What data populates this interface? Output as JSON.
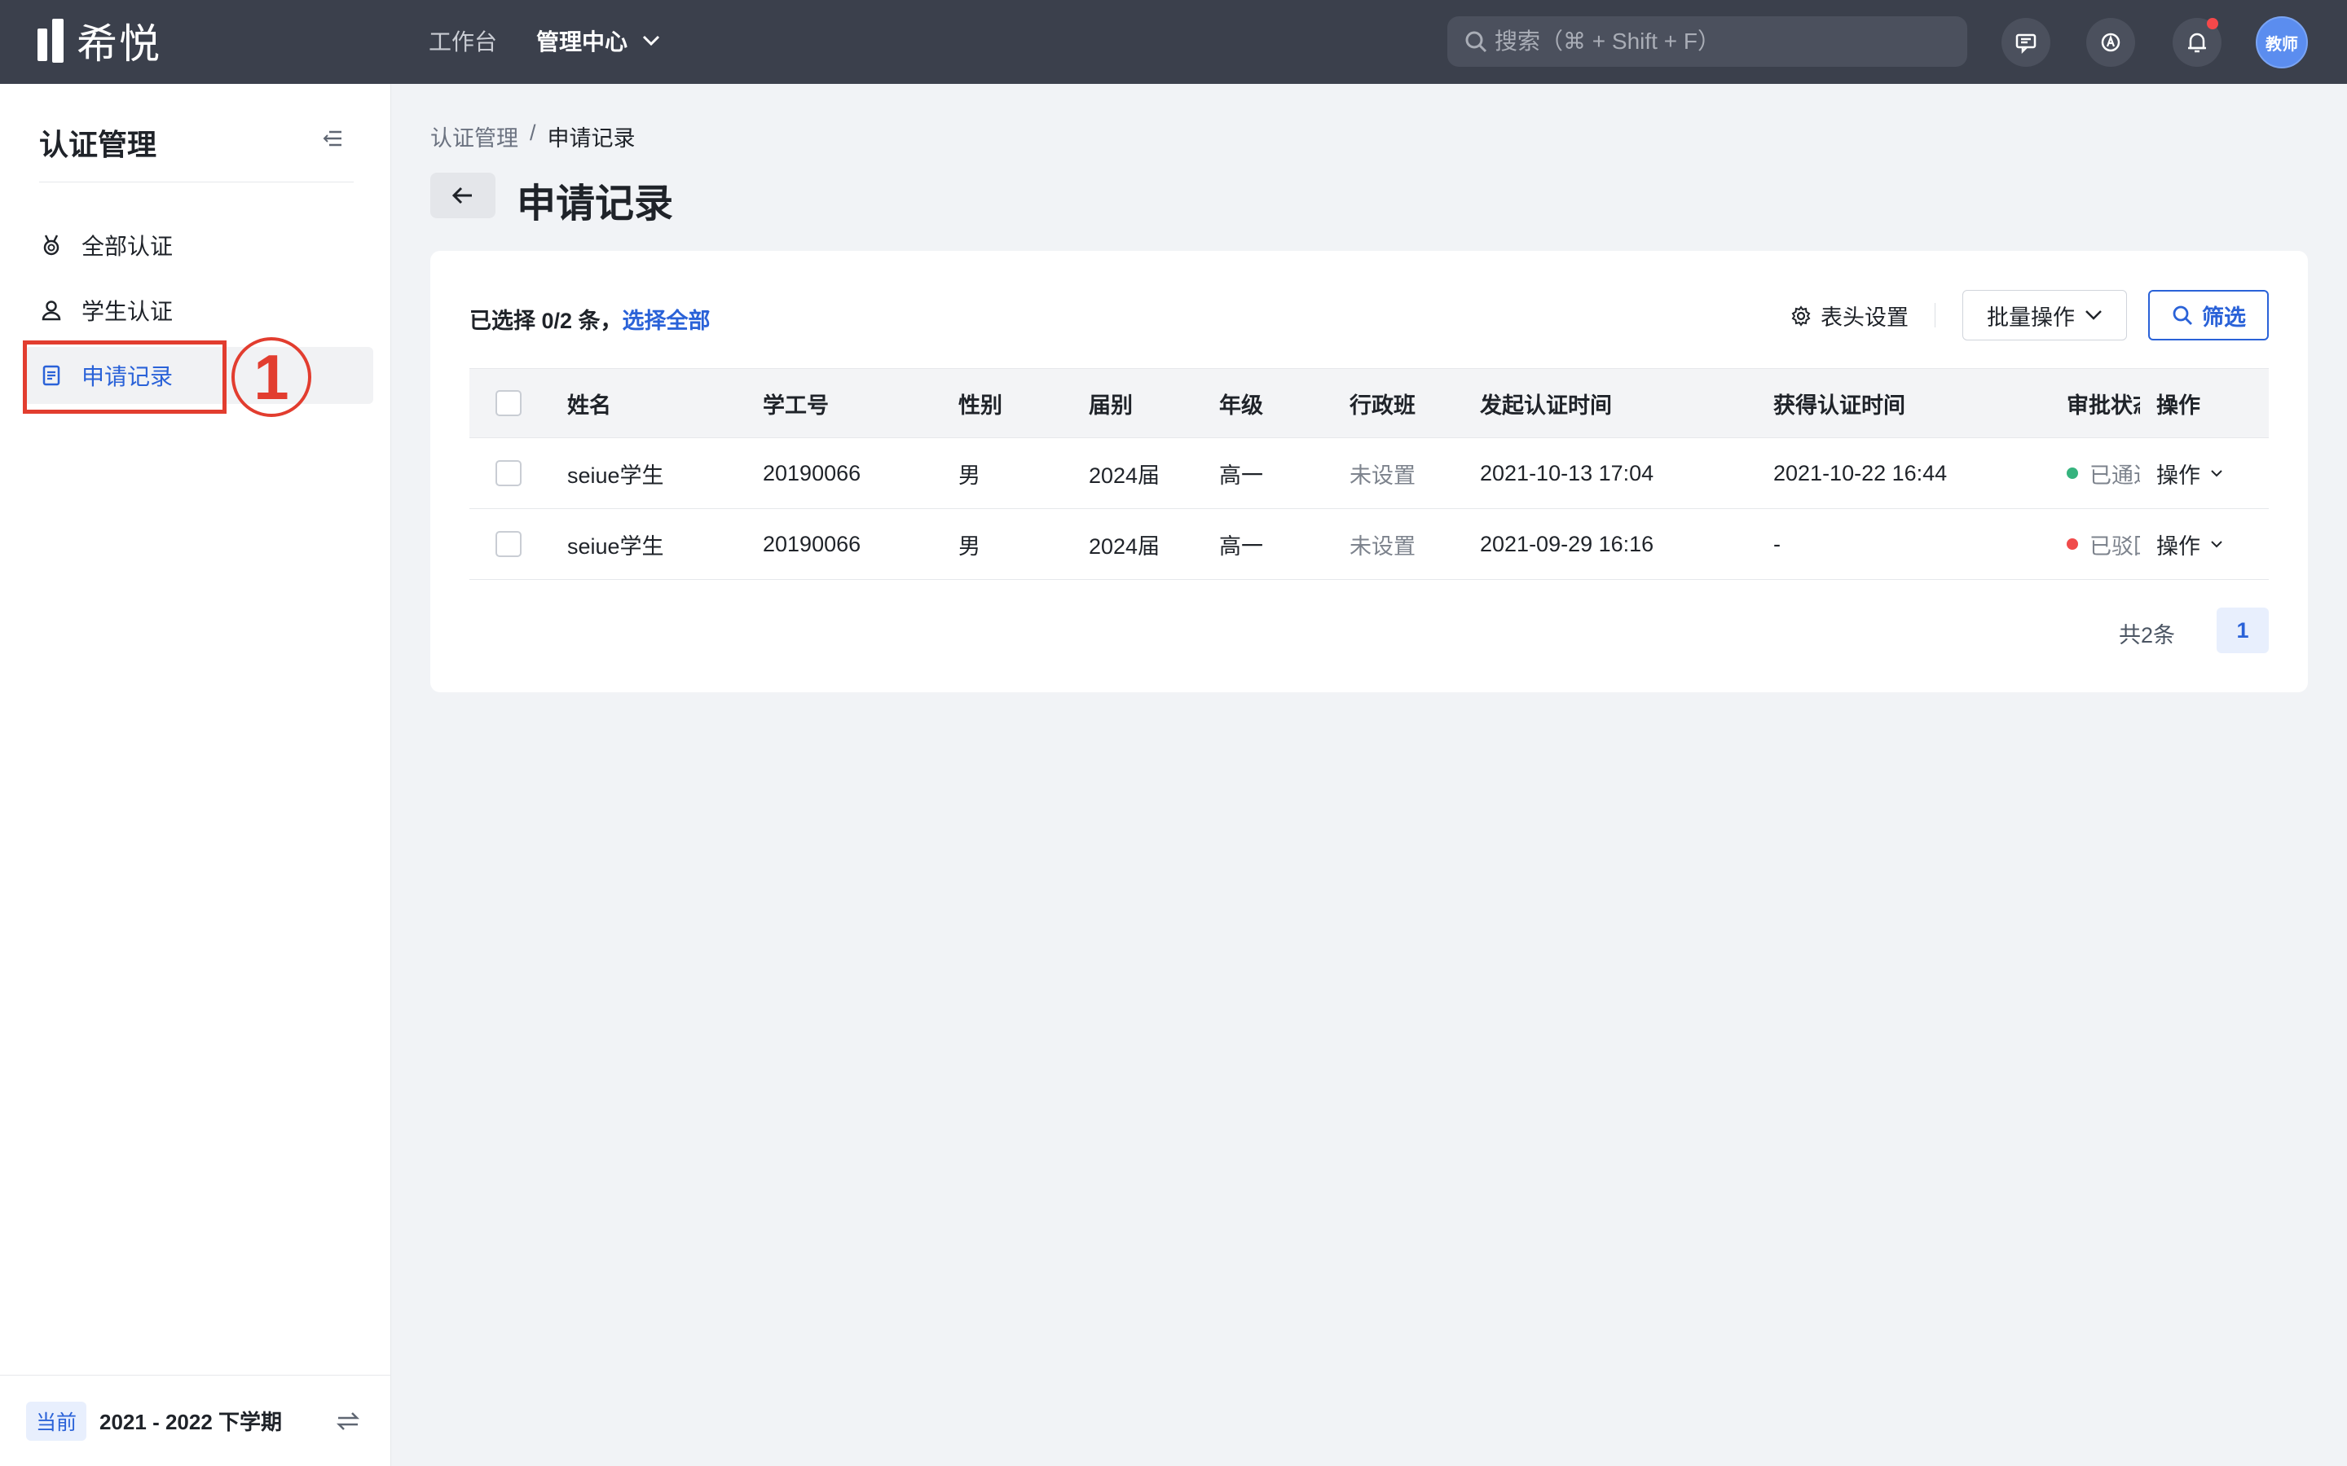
{
  "app": {
    "logo_text": "希悦",
    "nav": {
      "workbench": "工作台",
      "admin_center": "管理中心"
    },
    "search_placeholder": "搜索（⌘ + Shift + F）",
    "avatar_label": "教师"
  },
  "sidebar": {
    "title": "认证管理",
    "items": [
      {
        "label": "全部认证",
        "icon": "medal-icon"
      },
      {
        "label": "学生认证",
        "icon": "user-icon"
      },
      {
        "label": "申请记录",
        "icon": "document-icon",
        "active": true
      }
    ],
    "annotation": "1",
    "footer": {
      "badge": "当前",
      "term": "2021 - 2022 下学期"
    }
  },
  "main": {
    "breadcrumb": {
      "parent": "认证管理",
      "sep": "/",
      "current": "申请记录"
    },
    "title": "申请记录",
    "toolbar": {
      "selected_text": "已选择 0/2 条，",
      "select_all": "选择全部",
      "column_settings": "表头设置",
      "batch_ops": "批量操作",
      "filter": "筛选"
    },
    "table": {
      "headers": [
        "姓名",
        "学工号",
        "性别",
        "届别",
        "年级",
        "行政班",
        "发起认证时间",
        "获得认证时间",
        "审批状态",
        "操作"
      ],
      "rows": [
        {
          "name": "seiue学生",
          "id": "20190066",
          "gender": "男",
          "cohort": "2024届",
          "grade": "高一",
          "class": "未设置",
          "start": "2021-10-13 17:04",
          "got": "2021-10-22 16:44",
          "status": "已通过",
          "status_color": "#36b37e",
          "op": "操作"
        },
        {
          "name": "seiue学生",
          "id": "20190066",
          "gender": "男",
          "cohort": "2024届",
          "grade": "高一",
          "class": "未设置",
          "start": "2021-09-29 16:16",
          "got": "-",
          "status": "已驳回",
          "status_color": "#f04b4b",
          "op": "操作"
        }
      ]
    },
    "pagination": {
      "total": "共2条",
      "current_page": "1"
    }
  },
  "colors": {
    "accent": "#2a62d8",
    "topbar": "#3b404c",
    "annotation": "#e23d2f"
  }
}
